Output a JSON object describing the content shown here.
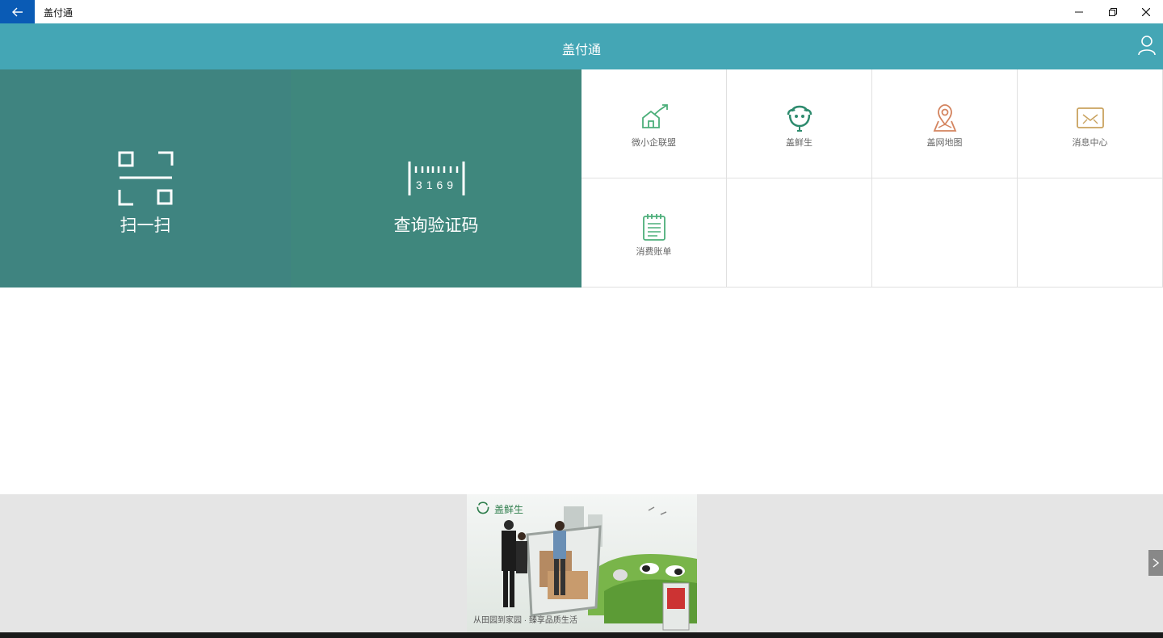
{
  "window": {
    "title": "盖付通"
  },
  "header": {
    "title": "盖付通"
  },
  "tiles": {
    "scan_label": "扫一扫",
    "verify_label": "查询验证码",
    "verify_code": "3169"
  },
  "grid": [
    {
      "label": "微小企联盟",
      "icon": "house-growth-icon",
      "color": "#4caf7a"
    },
    {
      "label": "盖鲜生",
      "icon": "gaixiansheng-logo-icon",
      "color": "#2e8b6e"
    },
    {
      "label": "盖网地图",
      "icon": "map-pin-icon",
      "color": "#d4845f"
    },
    {
      "label": "消息中心",
      "icon": "envelope-icon",
      "color": "#c9a25e"
    },
    {
      "label": "消费账单",
      "icon": "notepad-icon",
      "color": "#4caf7a"
    }
  ],
  "banner": {
    "brand": "盖鲜生",
    "slogan": "从田园到家园 · 臻享品质生活"
  },
  "colors": {
    "header": "#44a6b5",
    "scan_tile": "#3f8480",
    "verify_tile": "#3f877d",
    "back_button": "#0a5bb5"
  }
}
